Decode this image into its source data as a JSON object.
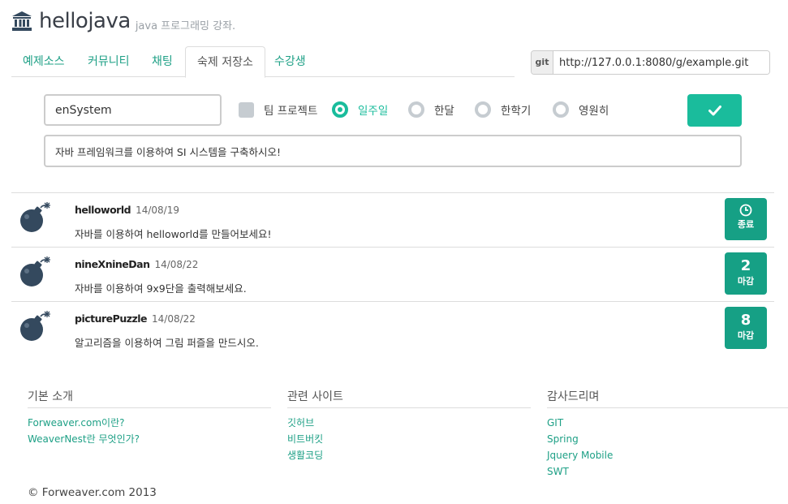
{
  "brand": {
    "title": "hellojava",
    "subtitle": "java 프로그래밍 강좌."
  },
  "tabs": [
    {
      "label": "예제소스",
      "active": false
    },
    {
      "label": "커뮤니티",
      "active": false
    },
    {
      "label": "채팅",
      "active": false
    },
    {
      "label": "숙제 저장소",
      "active": true
    },
    {
      "label": "수강생",
      "active": false
    }
  ],
  "git": {
    "addon": "git",
    "url": "http://127.0.0.1:8080/g/example.git"
  },
  "form": {
    "name_value": "enSystem",
    "team_project_label": "팀 프로젝트",
    "periods": [
      "일주일",
      "한달",
      "한학기",
      "영원히"
    ],
    "selected_period": "일주일",
    "description_value": "자바 프레임워크를 이용하여 SI 시스템을 구축하시오!",
    "submit_icon": "check-icon"
  },
  "assignments": [
    {
      "name": "helloworld",
      "date": "14/08/19",
      "desc": "자바를 이용하여 helloworld를 만들어보세요!",
      "badge_icon": "clock-icon",
      "badge_label": "종료"
    },
    {
      "name": "nineXnineDan",
      "date": "14/08/22",
      "desc": "자바를 이용하여 9x9단을 출력해보세요.",
      "badge_num": "2",
      "badge_label": "마감"
    },
    {
      "name": "picturePuzzle",
      "date": "14/08/22",
      "desc": "알고리즘을 이용하여 그림 퍼즐을 만드시오.",
      "badge_num": "8",
      "badge_label": "마감"
    }
  ],
  "footer": {
    "columns": [
      {
        "title": "기본 소개",
        "links": [
          "Forweaver.com이란?",
          "WeaverNest란 무엇인가?"
        ]
      },
      {
        "title": "관련 사이트",
        "links": [
          "깃허브",
          "비트버킷",
          "생활코딩"
        ]
      },
      {
        "title": "감사드리며",
        "links": [
          "GIT",
          "Spring",
          "Jquery Mobile",
          "SWT"
        ]
      }
    ],
    "copyright": "© Forweaver.com 2013"
  },
  "colors": {
    "accent": "#1abc9c",
    "badge": "#16a085",
    "link": "#1ea086",
    "bomb": "#34495e"
  }
}
